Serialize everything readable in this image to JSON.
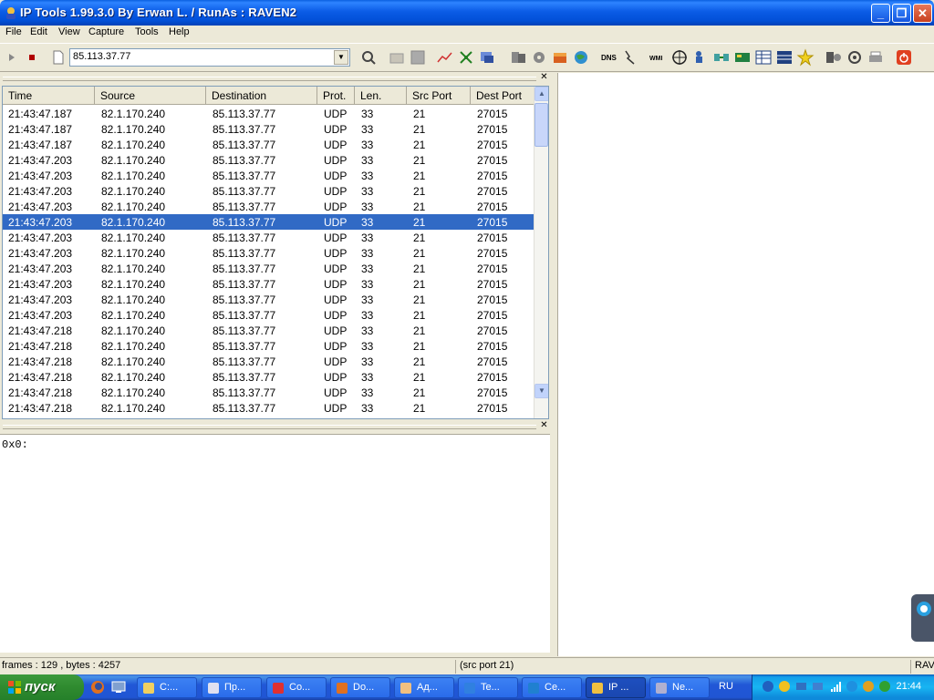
{
  "window": {
    "title": "IP Tools 1.99.3.0 By Erwan L. / RunAs : RAVEN2"
  },
  "menu": [
    "File",
    "Edit",
    "View",
    "Capture",
    "Tools",
    "Help"
  ],
  "toolbar": {
    "address_value": "85.113.37.77",
    "dns_label": "DNS",
    "wmi_label": "WMI"
  },
  "packets": {
    "columns": [
      "Time",
      "Source",
      "Destination",
      "Prot.",
      "Len.",
      "Src Port",
      "Dest Port"
    ],
    "rows": [
      [
        "21:43:47.187",
        "82.1.170.240",
        "85.113.37.77",
        "UDP",
        "33",
        "21",
        "27015"
      ],
      [
        "21:43:47.187",
        "82.1.170.240",
        "85.113.37.77",
        "UDP",
        "33",
        "21",
        "27015"
      ],
      [
        "21:43:47.187",
        "82.1.170.240",
        "85.113.37.77",
        "UDP",
        "33",
        "21",
        "27015"
      ],
      [
        "21:43:47.203",
        "82.1.170.240",
        "85.113.37.77",
        "UDP",
        "33",
        "21",
        "27015"
      ],
      [
        "21:43:47.203",
        "82.1.170.240",
        "85.113.37.77",
        "UDP",
        "33",
        "21",
        "27015"
      ],
      [
        "21:43:47.203",
        "82.1.170.240",
        "85.113.37.77",
        "UDP",
        "33",
        "21",
        "27015"
      ],
      [
        "21:43:47.203",
        "82.1.170.240",
        "85.113.37.77",
        "UDP",
        "33",
        "21",
        "27015"
      ],
      [
        "21:43:47.203",
        "82.1.170.240",
        "85.113.37.77",
        "UDP",
        "33",
        "21",
        "27015"
      ],
      [
        "21:43:47.203",
        "82.1.170.240",
        "85.113.37.77",
        "UDP",
        "33",
        "21",
        "27015"
      ],
      [
        "21:43:47.203",
        "82.1.170.240",
        "85.113.37.77",
        "UDP",
        "33",
        "21",
        "27015"
      ],
      [
        "21:43:47.203",
        "82.1.170.240",
        "85.113.37.77",
        "UDP",
        "33",
        "21",
        "27015"
      ],
      [
        "21:43:47.203",
        "82.1.170.240",
        "85.113.37.77",
        "UDP",
        "33",
        "21",
        "27015"
      ],
      [
        "21:43:47.203",
        "82.1.170.240",
        "85.113.37.77",
        "UDP",
        "33",
        "21",
        "27015"
      ],
      [
        "21:43:47.203",
        "82.1.170.240",
        "85.113.37.77",
        "UDP",
        "33",
        "21",
        "27015"
      ],
      [
        "21:43:47.218",
        "82.1.170.240",
        "85.113.37.77",
        "UDP",
        "33",
        "21",
        "27015"
      ],
      [
        "21:43:47.218",
        "82.1.170.240",
        "85.113.37.77",
        "UDP",
        "33",
        "21",
        "27015"
      ],
      [
        "21:43:47.218",
        "82.1.170.240",
        "85.113.37.77",
        "UDP",
        "33",
        "21",
        "27015"
      ],
      [
        "21:43:47.218",
        "82.1.170.240",
        "85.113.37.77",
        "UDP",
        "33",
        "21",
        "27015"
      ],
      [
        "21:43:47.218",
        "82.1.170.240",
        "85.113.37.77",
        "UDP",
        "33",
        "21",
        "27015"
      ],
      [
        "21:43:47.218",
        "82.1.170.240",
        "85.113.37.77",
        "UDP",
        "33",
        "21",
        "27015"
      ]
    ],
    "selected_index": 7
  },
  "hex": {
    "content": "0x0:"
  },
  "status": {
    "frames": "frames : 129 , bytes : 4257",
    "filter": "(src port 21)",
    "user": "RAV"
  },
  "taskbar": {
    "start_label": "пуск",
    "tasks": [
      "C:...",
      "Пр...",
      "Co...",
      "Do...",
      "Ад...",
      "Te...",
      "Ce...",
      "IP ...",
      "Ne..."
    ],
    "active_task": 7,
    "language": "RU",
    "clock": "21:44"
  },
  "colors": {
    "selection": "#316AC5",
    "titlebar": "#0B5CE6",
    "taskbar": "#2157D7",
    "start": "#2F8A2F"
  }
}
